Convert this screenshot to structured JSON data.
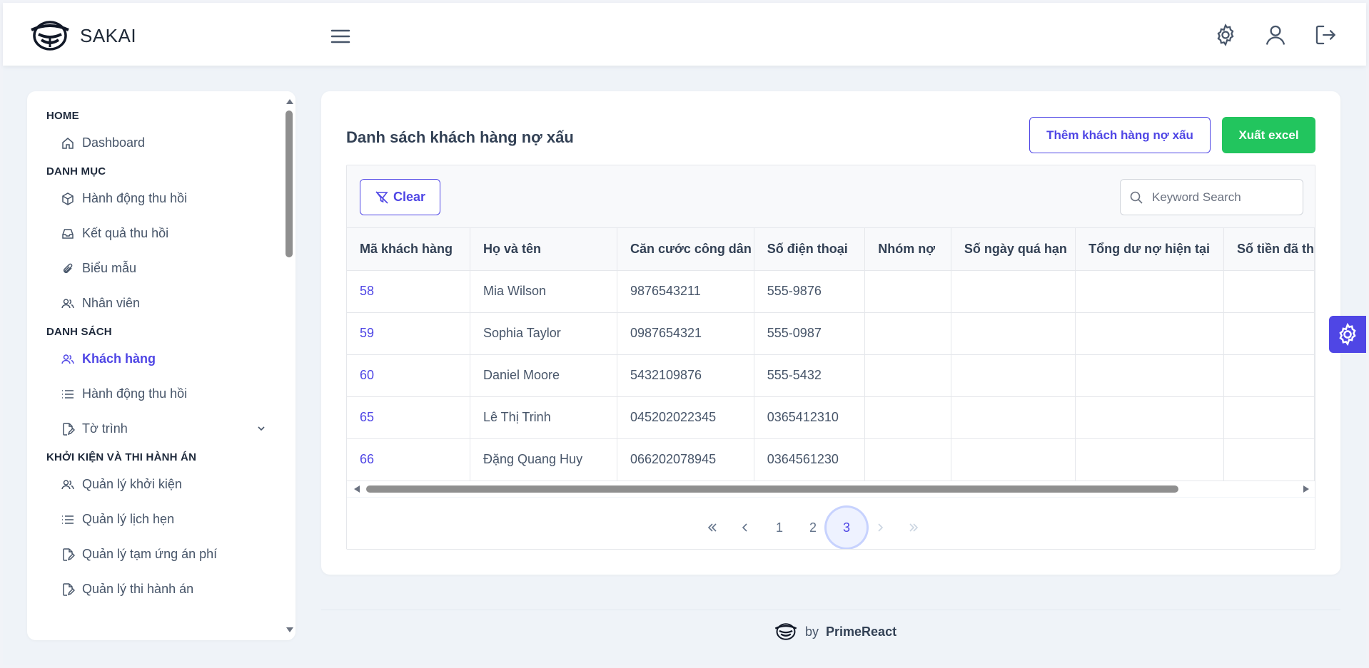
{
  "app": {
    "name": "SAKAI"
  },
  "sidebar": {
    "sections": [
      {
        "title": "HOME",
        "items": [
          {
            "label": "Dashboard",
            "icon": "home-icon"
          }
        ]
      },
      {
        "title": "DANH MỤC",
        "items": [
          {
            "label": "Hành động thu hồi",
            "icon": "box-icon"
          },
          {
            "label": "Kết quả thu hồi",
            "icon": "inbox-icon"
          },
          {
            "label": "Biểu mẫu",
            "icon": "paperclip-icon"
          },
          {
            "label": "Nhân viên",
            "icon": "users-icon"
          }
        ]
      },
      {
        "title": "DANH SÁCH",
        "items": [
          {
            "label": "Khách hàng",
            "icon": "users-icon",
            "active": true
          },
          {
            "label": "Hành động thu hồi",
            "icon": "list-icon"
          },
          {
            "label": "Tờ trình",
            "icon": "file-edit-icon",
            "expandable": true
          }
        ]
      },
      {
        "title": "KHỞI KIỆN VÀ THI HÀNH ÁN",
        "items": [
          {
            "label": "Quản lý khởi kiện",
            "icon": "users-icon"
          },
          {
            "label": "Quản lý lịch hẹn",
            "icon": "list-icon"
          },
          {
            "label": "Quản lý tạm ứng án phí",
            "icon": "file-edit-icon"
          },
          {
            "label": "Quản lý thi hành án",
            "icon": "file-edit-icon"
          }
        ]
      }
    ]
  },
  "main": {
    "title": "Danh sách khách hàng nợ xấu",
    "add_button": "Thêm khách hàng nợ xấu",
    "export_button": "Xuất excel",
    "clear_button": "Clear",
    "search_placeholder": "Keyword Search",
    "columns": [
      "Mã khách hàng",
      "Họ và tên",
      "Căn cước công dân",
      "Số điện thoại",
      "Nhóm nợ",
      "Số ngày quá hạn",
      "Tổng dư nợ hiện tại",
      "Số tiền đã th"
    ],
    "rows": [
      {
        "id": "58",
        "name": "Mia Wilson",
        "cccd": "9876543211",
        "phone": "555-9876"
      },
      {
        "id": "59",
        "name": "Sophia Taylor",
        "cccd": "0987654321",
        "phone": "555-0987"
      },
      {
        "id": "60",
        "name": "Daniel Moore",
        "cccd": "5432109876",
        "phone": "555-5432"
      },
      {
        "id": "65",
        "name": "Lê Thị Trinh",
        "cccd": "045202022345",
        "phone": "0365412310"
      },
      {
        "id": "66",
        "name": "Đặng Quang Huy",
        "cccd": "066202078945",
        "phone": "0364561230"
      }
    ],
    "pagination": {
      "pages": [
        "1",
        "2",
        "3"
      ],
      "current": "3"
    }
  },
  "footer": {
    "by": "by",
    "brand": "PrimeReact"
  },
  "colors": {
    "primary": "#4f46e5",
    "success": "#22c55e",
    "background": "#eff3f8"
  }
}
